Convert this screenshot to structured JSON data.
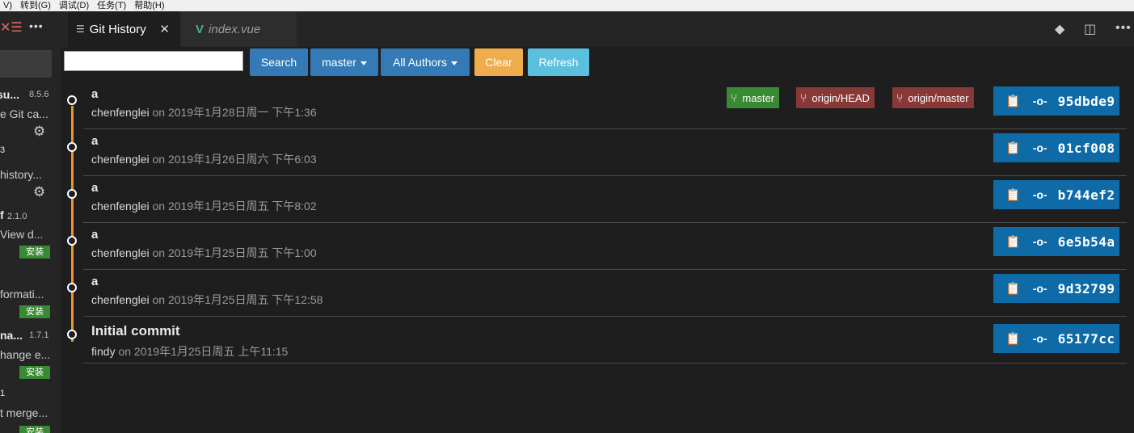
{
  "menubar": [
    "V)",
    "转到(G)",
    "调试(D)",
    "任务(T)",
    "帮助(H)"
  ],
  "sidebar": {
    "more_glyph": "•••",
    "extensions": [
      {
        "name": "su...",
        "version": "8.5.6",
        "desc": "e Git ca...",
        "action": "gear"
      },
      {
        "name": "3",
        "version": "",
        "desc": " history...",
        "action": "gear"
      },
      {
        "name": "f",
        "version": "2.1.0",
        "desc": " View d...",
        "action": "安装"
      },
      {
        "name": "",
        "version": "",
        "desc": "formati...",
        "action": "安装"
      },
      {
        "name": "na...",
        "version": "1.7.1",
        "desc": "hange e...",
        "action": "安装"
      },
      {
        "name": "1",
        "version": "",
        "desc": "t merge...",
        "action": "安装"
      }
    ]
  },
  "tabs": [
    {
      "label": "Git History",
      "active": true,
      "icon": "list-icon"
    },
    {
      "label": "index.vue",
      "active": false,
      "icon": "vue-icon"
    }
  ],
  "toolbar": {
    "search_placeholder": "",
    "search_label": "Search",
    "branch_label": "master",
    "authors_label": "All Authors",
    "clear_label": "Clear",
    "refresh_label": "Refresh"
  },
  "commits": [
    {
      "message": "a",
      "author": "chenfenglei",
      "date": " on 2019年1月28日周一 下午1:36",
      "hash": "95dbde9",
      "refs": [
        {
          "label": "master",
          "type": "local"
        },
        {
          "label": "origin/HEAD",
          "type": "remote"
        },
        {
          "label": "origin/master",
          "type": "remote"
        }
      ]
    },
    {
      "message": "a",
      "author": "chenfenglei",
      "date": " on 2019年1月26日周六 下午6:03",
      "hash": "01cf008",
      "refs": []
    },
    {
      "message": "a",
      "author": "chenfenglei",
      "date": " on 2019年1月25日周五 下午8:02",
      "hash": "b744ef2",
      "refs": []
    },
    {
      "message": "a",
      "author": "chenfenglei",
      "date": " on 2019年1月25日周五 下午1:00",
      "hash": "6e5b54a",
      "refs": []
    },
    {
      "message": "a",
      "author": "chenfenglei",
      "date": " on 2019年1月25日周五 下午12:58",
      "hash": "9d32799",
      "refs": []
    },
    {
      "message": "Initial commit",
      "author": "findy",
      "date": " on 2019年1月25日周五 上午11:15",
      "hash": "65177cc",
      "refs": []
    }
  ],
  "colors": {
    "graph_line": "#f2912b",
    "local_branch": "#388a34",
    "remote_branch": "#893838",
    "hash_button": "#0e6ba8"
  }
}
